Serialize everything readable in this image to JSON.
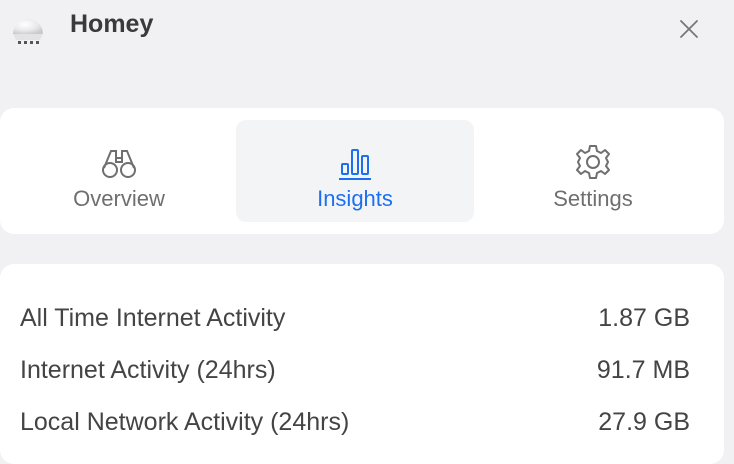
{
  "header": {
    "title": "Homey",
    "device_icon": "homey-device-icon",
    "close_icon": "close-icon"
  },
  "tabs": [
    {
      "label": "Overview",
      "icon": "binoculars-icon",
      "active": false
    },
    {
      "label": "Insights",
      "icon": "bar-chart-icon",
      "active": true
    },
    {
      "label": "Settings",
      "icon": "gear-icon",
      "active": false
    }
  ],
  "stats": [
    {
      "label": "All Time Internet Activity",
      "value": "1.87 GB"
    },
    {
      "label": "Internet Activity (24hrs)",
      "value": "91.7 MB"
    },
    {
      "label": "Local Network Activity (24hrs)",
      "value": "27.9 GB"
    }
  ],
  "colors": {
    "accent": "#1d6ff2",
    "background": "#f1f1f4",
    "card": "#ffffff",
    "active_tab": "#f3f4f6"
  }
}
